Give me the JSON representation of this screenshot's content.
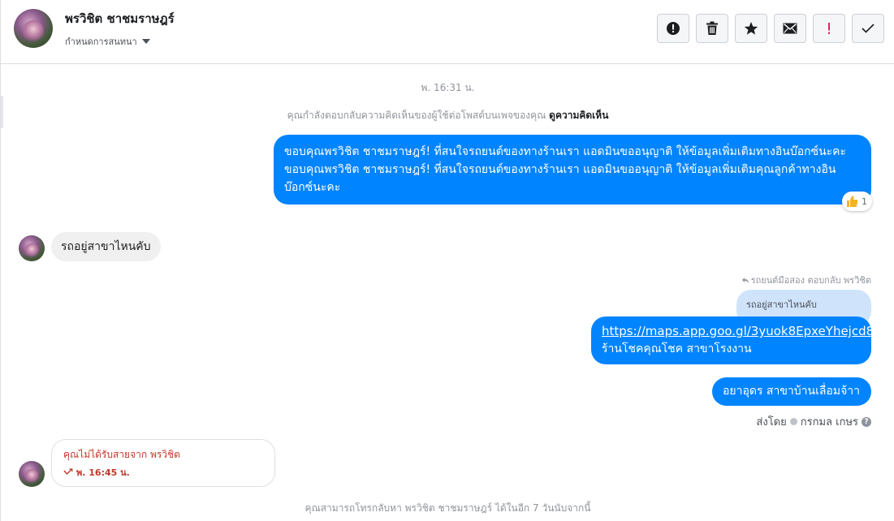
{
  "header": {
    "name": "พรวิชิต ชาชมราษฎร์",
    "assign_label": "กำหนดการสนทนา",
    "toolbar": [
      {
        "icon": "alert-circle-icon",
        "name": "mark-spam-button"
      },
      {
        "icon": "trash-icon",
        "name": "delete-button"
      },
      {
        "icon": "star-icon",
        "name": "star-button"
      },
      {
        "icon": "envelope-icon",
        "name": "mark-unread-button"
      },
      {
        "icon": "exclamation-icon",
        "name": "follow-up-button"
      },
      {
        "icon": "checkmark-icon",
        "name": "done-button"
      }
    ]
  },
  "conversation": {
    "timestamp": "พ. 16:31 น.",
    "replying_notice": "คุณกำลังตอบกลับความคิดเห็นของผู้ใช้ต่อโพสต์บนเพจของคุณ",
    "replying_link": "ดูความคิดเห็น",
    "messages": [
      {
        "text": "ขอบคุณพรวิชิต ชาชมราษฎร์! ที่สนใจรถยนต์ของทางร้านเรา แอดมินขออนุญาติ ให้ข้อมูลเพิ่มเติมทางอินบ๊อกซ์นะคะขอบคุณพรวิชิต ชาชมราษฎร์! ที่สนใจรถยนต์ของทางร้านเรา แอดมินขออนุญาติ ให้ข้อมูลเพิ่มเติมคุณลูกค้าทางอินบ๊อกซ์นะคะ",
        "reaction_count": "1",
        "reaction_icon": "thumbs-up-icon"
      },
      {
        "text": "รถอยู่สาขาไหนคับ"
      },
      {
        "reply_meta": "รถยนต์มือสอง ตอบกลับ พรวิชิต",
        "quoted": "รถอยู่สาขาไหนคับ",
        "url": "https://maps.app.goo.gl/3yuok8EpxeYhejcd8",
        "text": "ร้านโชคคุณโชค สาขาโรงงาน"
      },
      {
        "text": "อยาอุดร สาขาบ้านเลื่อมจ้าา",
        "sent_by_label": "ส่งโดย",
        "sent_by_name": "กรกมล เกษร"
      }
    ],
    "missed_call": {
      "title": "คุณไม่ได้รับสายจาก พรวิชิต",
      "time": "พ. 16:45 น."
    },
    "footer_note": "คุณสามารถโทรกลับหา พรวิชิต ชาชมราษฎร์ ได้ในอีก 7 วันนับจากนี้"
  },
  "colors": {
    "outgoing_bubble": "#0084ff",
    "incoming_bubble": "#f1f0f0",
    "quoted_bubble": "#cfe3fb",
    "missed_call": "#c0392b"
  }
}
